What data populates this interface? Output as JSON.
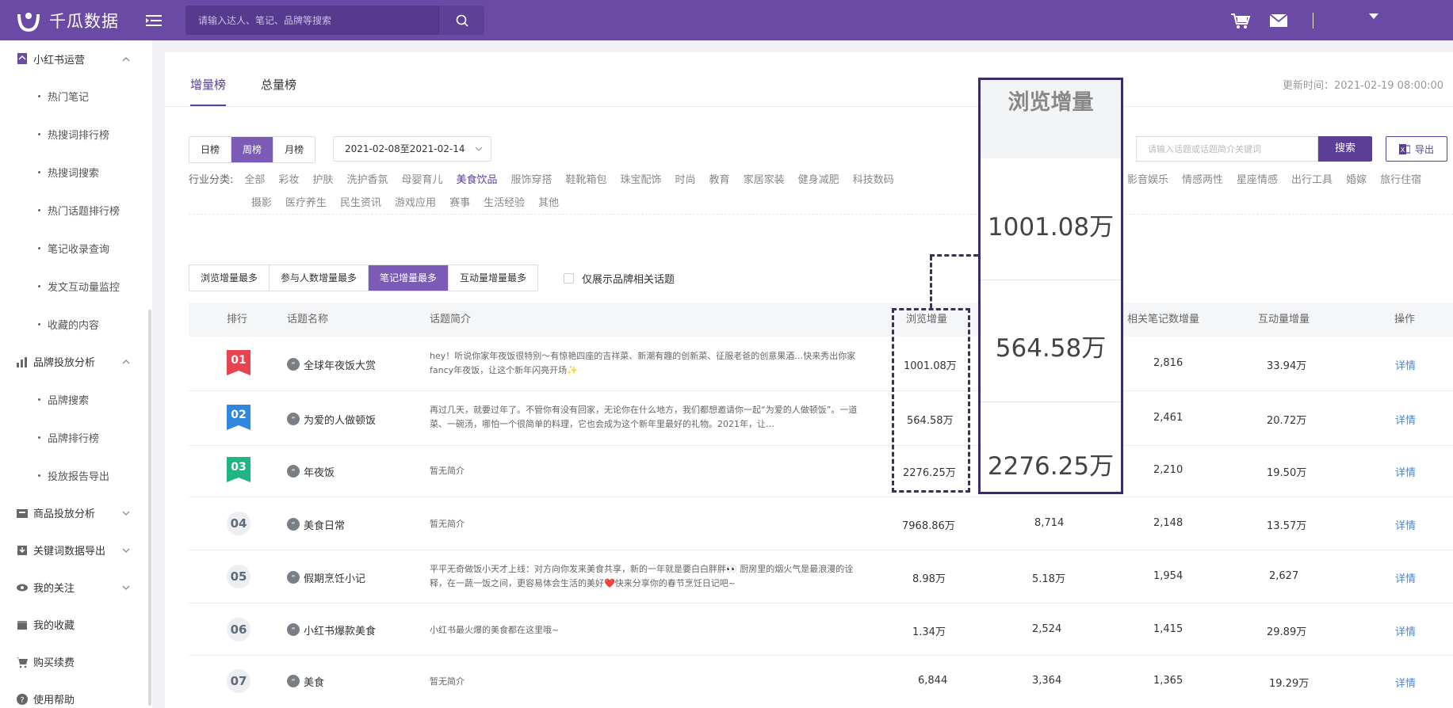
{
  "brand": {
    "name": "千瓜数据"
  },
  "search": {
    "placeholder": "请输入达人、笔记、品牌等搜索"
  },
  "colors": {
    "topbar": "#6a4aa4",
    "accent": "#5b3e96",
    "rank1": "#e8434f",
    "rank2": "#2f88e0",
    "rank3": "#1fb584",
    "link": "#4a88d1"
  },
  "sidebar": {
    "groups": [
      {
        "label": "小红书运营",
        "icon": "xiaohongshu-icon",
        "expanded": true,
        "items": [
          "热门笔记",
          "热搜词排行榜",
          "热搜词搜索",
          "热门话题排行榜",
          "笔记收录查询",
          "发文互动量监控",
          "收藏的内容"
        ]
      },
      {
        "label": "品牌投放分析",
        "icon": "chart-icon",
        "expanded": true,
        "items": [
          "品牌搜索",
          "品牌排行榜",
          "投放报告导出"
        ]
      },
      {
        "label": "商品投放分析",
        "icon": "goods-icon",
        "expanded": false,
        "items": []
      },
      {
        "label": "关键词数据导出",
        "icon": "download-icon",
        "expanded": false,
        "items": []
      },
      {
        "label": "我的关注",
        "icon": "eye-icon",
        "expanded": false,
        "items": []
      },
      {
        "label": "我的收藏",
        "icon": "favorites-icon",
        "expanded": null,
        "items": []
      },
      {
        "label": "购买续费",
        "icon": "cart-icon",
        "expanded": null,
        "items": []
      },
      {
        "label": "使用帮助",
        "icon": "help-icon",
        "expanded": null,
        "items": []
      }
    ]
  },
  "tabs": [
    {
      "label": "增量榜",
      "active": true
    },
    {
      "label": "总量榜",
      "active": false
    }
  ],
  "update_time": "更新时间：2021-02-19 08:00:00",
  "period": {
    "options": [
      "日榜",
      "周榜",
      "月榜"
    ],
    "selected": "周榜"
  },
  "date_range": "2021-02-08至2021-02-14",
  "keyword": {
    "placeholder": "请输入话题或话题简介关键词",
    "button": "搜索"
  },
  "export": {
    "label": "导出"
  },
  "categories": {
    "label": "行业分类:",
    "row1_left": [
      "全部",
      "彩妆",
      "护肤",
      "洗护香氛",
      "母婴育儿",
      "美食饮品",
      "服饰穿搭",
      "鞋靴箱包",
      "珠宝配饰",
      "时尚",
      "教育",
      "家居家装",
      "健身减肥",
      "科技数码"
    ],
    "row1_right": [
      "影音娱乐",
      "情感两性",
      "星座情感",
      "出行工具",
      "婚嫁",
      "旅行住宿"
    ],
    "row2": [
      "摄影",
      "医疗养生",
      "民生资讯",
      "游戏应用",
      "赛事",
      "生活经验",
      "其他"
    ],
    "selected": "美食饮品"
  },
  "sort": {
    "options": [
      "浏览增量最多",
      "参与人数增量最多",
      "笔记增量最多",
      "互动量增量最多"
    ],
    "selected": "笔记增量最多"
  },
  "brand_only": {
    "label": "仅展示品牌相关话题",
    "checked": false
  },
  "table": {
    "headers": {
      "rank": "排行",
      "name": "话题名称",
      "desc": "话题简介",
      "views": "浏览增量",
      "notes": "相关笔记数增量",
      "interactions": "互动量增量",
      "action": "操作"
    },
    "rows": [
      {
        "rank": "01",
        "name": "全球年夜饭大赏",
        "desc": "hey！听说你家年夜饭很特别～有惊艳四座的吉祥菜、新潮有趣的创新菜、征服老爸的创意果酒…快来秀出你家fancy年夜饭，让这个新年闪亮开场✨",
        "views": "1001.08万",
        "participants": "",
        "notes": "2,816",
        "interactions": "33.94万",
        "action": "详情"
      },
      {
        "rank": "02",
        "name": "为爱的人做顿饭",
        "desc": "再过几天，就要过年了。不管你有没有回家，无论你在什么地方，我们都想邀请你一起“为爱的人做顿饭”。一道菜、一碗汤，哪怕一个很简单的料理，它也会成为这个新年里最好的礼物。2021年，让…",
        "views": "564.58万",
        "participants": "",
        "notes": "2,461",
        "interactions": "20.72万",
        "action": "详情"
      },
      {
        "rank": "03",
        "name": "年夜饭",
        "desc": "暂无简介",
        "views": "2276.25万",
        "participants": "",
        "notes": "2,210",
        "interactions": "19.50万",
        "action": "详情"
      },
      {
        "rank": "04",
        "name": "美食日常",
        "desc": "暂无简介",
        "views": "7968.86万",
        "participants": "8,714",
        "notes": "2,148",
        "interactions": "13.57万",
        "action": "详情"
      },
      {
        "rank": "05",
        "name": "假期烹饪小记",
        "desc": "平平无奇做饭小天才上线：对方向你发来美食共享，新的一年就是要白白胖胖👀 厨房里的烟火气是最浪漫的诠释，在一蔬一饭之间，更容易体会生活的美好❤️快来分享你的春节烹饪日记吧~",
        "views": "8.98万",
        "participants": "5.18万",
        "notes": "1,954",
        "interactions": "2,627",
        "action": "详情"
      },
      {
        "rank": "06",
        "name": "小红书爆款美食",
        "desc": "小红书最火爆的美食都在这里哦~",
        "views": "1.34万",
        "participants": "2,524",
        "notes": "1,415",
        "interactions": "29.89万",
        "action": "详情"
      },
      {
        "rank": "07",
        "name": "美食",
        "desc": "暂无简介",
        "views": "6,844",
        "participants": "3,364",
        "notes": "1,365",
        "interactions": "19.29万",
        "action": "详情"
      }
    ]
  },
  "zoom_callout": {
    "title": "浏览增量",
    "values": [
      "1001.08万",
      "564.58万",
      "2276.25万"
    ]
  }
}
